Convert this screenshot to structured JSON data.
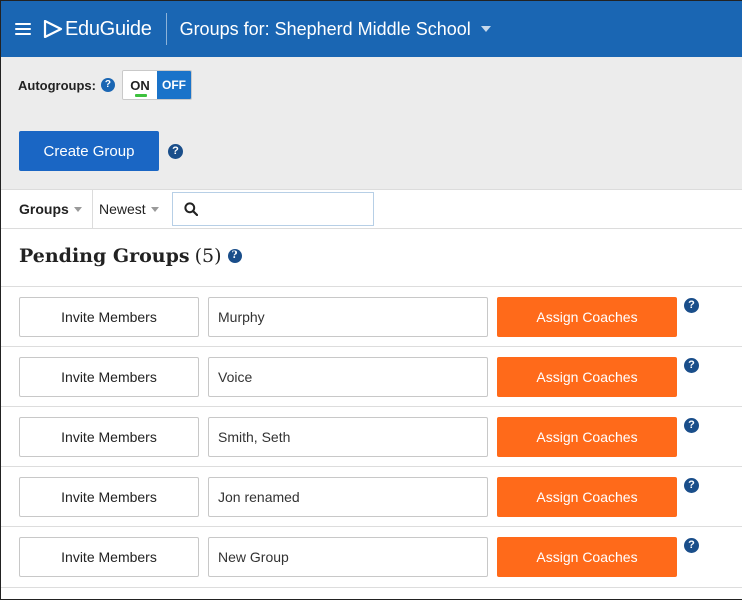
{
  "header": {
    "logo_text": "EduGuide",
    "title": "Groups for: Shepherd Middle School"
  },
  "autogroups": {
    "label": "Autogroups:",
    "on_label": "ON",
    "off_label": "OFF"
  },
  "create_group_label": "Create Group",
  "filters": {
    "groups_label": "Groups",
    "sort_label": "Newest",
    "search_value": ""
  },
  "pending": {
    "title": "Pending Groups",
    "count": "(5)",
    "invite_label": "Invite Members",
    "assign_label": "Assign Coaches",
    "groups": [
      {
        "name": "Murphy"
      },
      {
        "name": "Voice"
      },
      {
        "name": "Smith, Seth"
      },
      {
        "name": "Jon renamed"
      },
      {
        "name": "New Group"
      }
    ]
  },
  "help_glyph": "?",
  "colors": {
    "header_bg": "#1a66b3",
    "primary_button": "#1a66c4",
    "assign_button": "#ff6a1a",
    "panel_bg": "#ececec",
    "toggle_on_indicator": "#3dc13d"
  }
}
